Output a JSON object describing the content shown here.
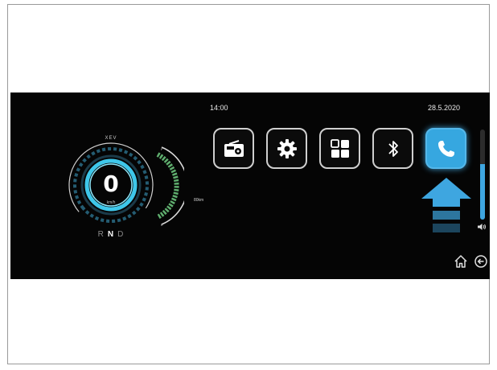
{
  "status_bar": {
    "time": "14:00",
    "date": "28.5.2020"
  },
  "cluster": {
    "brand": "XEV",
    "speed": "0",
    "speed_unit": "km/h",
    "range": "80km",
    "gears": [
      "R",
      "N",
      "D"
    ],
    "selected_gear": "N"
  },
  "apps": [
    {
      "icon": "radio-icon"
    },
    {
      "icon": "gear-icon"
    },
    {
      "icon": "grid-icon"
    },
    {
      "icon": "bluetooth-icon"
    },
    {
      "icon": "phone-icon",
      "selected": true
    }
  ],
  "volume": {
    "level": 0.62
  },
  "colors": {
    "accent": "#36a7e0",
    "background": "#050505",
    "gauge": "#3ec7ea"
  }
}
